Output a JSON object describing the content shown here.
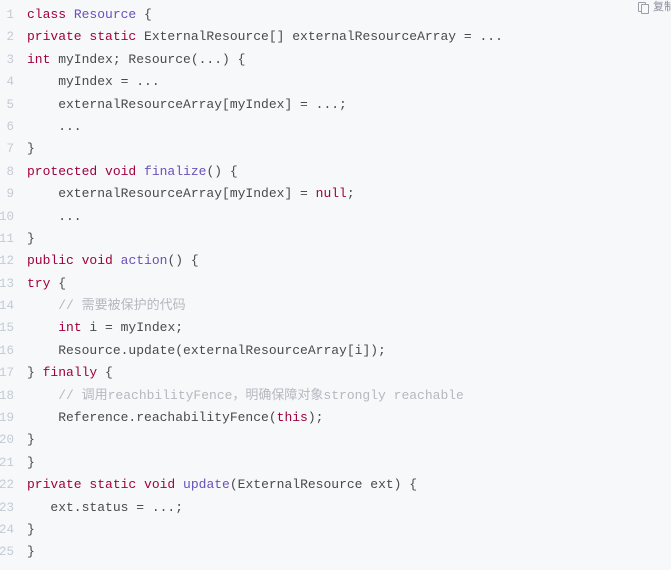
{
  "toolbar": {
    "copy_label": "复制",
    "copy_icon": "copy-icon"
  },
  "colors": {
    "background": "#f7f8fa",
    "keyword": "#a1003f",
    "type": "#6b4fbb",
    "comment": "#b4b8bf",
    "plain": "#4a4a4a",
    "line_number": "#c3cbd6"
  },
  "code": {
    "language": "java",
    "lines": [
      {
        "n": "1",
        "tokens": [
          {
            "t": "class",
            "c": "kw"
          },
          {
            "t": " ",
            "c": "pl"
          },
          {
            "t": "Resource",
            "c": "ty"
          },
          {
            "t": " {",
            "c": "pl"
          }
        ]
      },
      {
        "n": "2",
        "tokens": [
          {
            "t": "private static",
            "c": "kw"
          },
          {
            "t": " ExternalResource[] externalResourceArray = ...",
            "c": "pl"
          }
        ]
      },
      {
        "n": "3",
        "tokens": [
          {
            "t": "int",
            "c": "kw"
          },
          {
            "t": " myIndex; Resource(...) {",
            "c": "pl"
          }
        ]
      },
      {
        "n": "4",
        "tokens": [
          {
            "t": "    myIndex = ...",
            "c": "pl"
          }
        ]
      },
      {
        "n": "5",
        "tokens": [
          {
            "t": "    externalResourceArray[myIndex] = ...;",
            "c": "pl"
          }
        ]
      },
      {
        "n": "6",
        "tokens": [
          {
            "t": "    ...",
            "c": "pl"
          }
        ]
      },
      {
        "n": "7",
        "tokens": [
          {
            "t": "}",
            "c": "pl"
          }
        ]
      },
      {
        "n": "8",
        "tokens": [
          {
            "t": "protected void",
            "c": "kw"
          },
          {
            "t": " ",
            "c": "pl"
          },
          {
            "t": "finalize",
            "c": "ty"
          },
          {
            "t": "() {",
            "c": "pl"
          }
        ]
      },
      {
        "n": "9",
        "tokens": [
          {
            "t": "    externalResourceArray[myIndex] = ",
            "c": "pl"
          },
          {
            "t": "null",
            "c": "kw"
          },
          {
            "t": ";",
            "c": "pl"
          }
        ]
      },
      {
        "n": "10",
        "tokens": [
          {
            "t": "    ...",
            "c": "pl"
          }
        ]
      },
      {
        "n": "11",
        "tokens": [
          {
            "t": "}",
            "c": "pl"
          }
        ]
      },
      {
        "n": "12",
        "tokens": [
          {
            "t": "public void",
            "c": "kw"
          },
          {
            "t": " ",
            "c": "pl"
          },
          {
            "t": "action",
            "c": "ty"
          },
          {
            "t": "() {",
            "c": "pl"
          }
        ]
      },
      {
        "n": "13",
        "tokens": [
          {
            "t": "try",
            "c": "kw"
          },
          {
            "t": " {",
            "c": "pl"
          }
        ]
      },
      {
        "n": "14",
        "tokens": [
          {
            "t": "    // 需要被保护的代码",
            "c": "cm"
          }
        ]
      },
      {
        "n": "15",
        "tokens": [
          {
            "t": "    ",
            "c": "pl"
          },
          {
            "t": "int",
            "c": "kw"
          },
          {
            "t": " i = myIndex;",
            "c": "pl"
          }
        ]
      },
      {
        "n": "16",
        "tokens": [
          {
            "t": "    Resource.update(externalResourceArray[i]);",
            "c": "pl"
          }
        ]
      },
      {
        "n": "17",
        "tokens": [
          {
            "t": "} ",
            "c": "pl"
          },
          {
            "t": "finally",
            "c": "kw"
          },
          {
            "t": " {",
            "c": "pl"
          }
        ]
      },
      {
        "n": "18",
        "tokens": [
          {
            "t": "    // 调用reachbilityFence，明确保障对象strongly reachable",
            "c": "cm"
          }
        ]
      },
      {
        "n": "19",
        "tokens": [
          {
            "t": "    Reference.reachabilityFence(",
            "c": "pl"
          },
          {
            "t": "this",
            "c": "kw"
          },
          {
            "t": ");",
            "c": "pl"
          }
        ]
      },
      {
        "n": "20",
        "tokens": [
          {
            "t": "}",
            "c": "pl"
          }
        ]
      },
      {
        "n": "21",
        "tokens": [
          {
            "t": "}",
            "c": "pl"
          }
        ]
      },
      {
        "n": "22",
        "tokens": [
          {
            "t": "private static void",
            "c": "kw"
          },
          {
            "t": " ",
            "c": "pl"
          },
          {
            "t": "update",
            "c": "ty"
          },
          {
            "t": "(ExternalResource ext) {",
            "c": "pl"
          }
        ]
      },
      {
        "n": "23",
        "tokens": [
          {
            "t": "   ext.status = ...;",
            "c": "pl"
          }
        ]
      },
      {
        "n": "24",
        "tokens": [
          {
            "t": "}",
            "c": "pl"
          }
        ]
      },
      {
        "n": "25",
        "tokens": [
          {
            "t": "}",
            "c": "pl"
          }
        ]
      }
    ]
  }
}
